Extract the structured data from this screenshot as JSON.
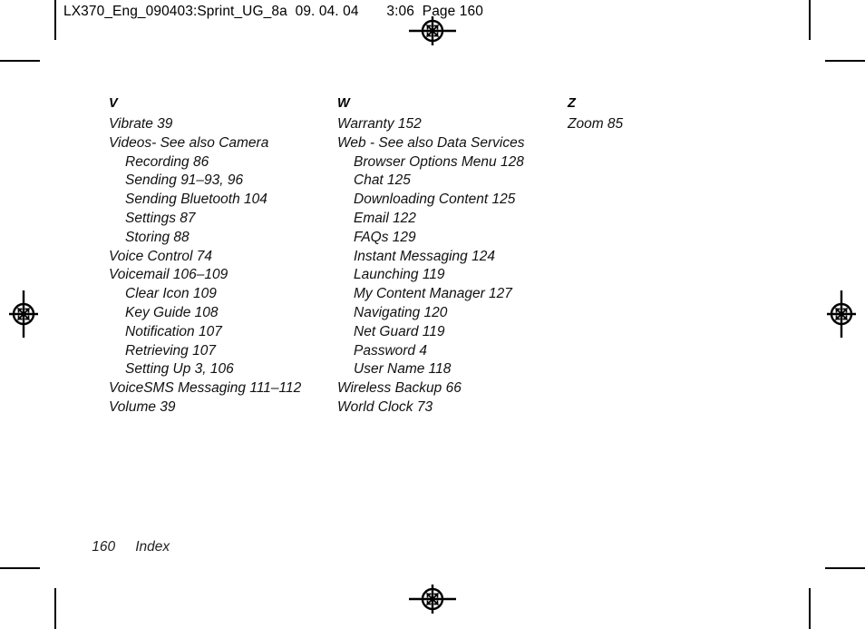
{
  "header": {
    "slug": "LX370_Eng_090403:Sprint_UG_8a  09. 04. 04       3:06  Page 160"
  },
  "index": {
    "columns": [
      {
        "letter": "V",
        "entries": [
          {
            "text": "Vibrate 39",
            "level": 0
          },
          {
            "text": "Videos- See also Camera",
            "level": 0
          },
          {
            "text": "Recording 86",
            "level": 1
          },
          {
            "text": "Sending 91–93, 96",
            "level": 1
          },
          {
            "text": "Sending Bluetooth 104",
            "level": 1
          },
          {
            "text": "Settings 87",
            "level": 1
          },
          {
            "text": "Storing 88",
            "level": 1
          },
          {
            "text": "Voice Control 74",
            "level": 0
          },
          {
            "text": "Voicemail 106–109",
            "level": 0
          },
          {
            "text": "Clear Icon 109",
            "level": 1
          },
          {
            "text": "Key Guide 108",
            "level": 1
          },
          {
            "text": "Notification 107",
            "level": 1
          },
          {
            "text": "Retrieving 107",
            "level": 1
          },
          {
            "text": "Setting Up 3, 106",
            "level": 1
          },
          {
            "text": "VoiceSMS Messaging 111–112",
            "level": 0
          },
          {
            "text": "Volume 39",
            "level": 0
          }
        ]
      },
      {
        "letter": "W",
        "entries": [
          {
            "text": "Warranty 152",
            "level": 0
          },
          {
            "text": "Web - See also Data Services",
            "level": 0
          },
          {
            "text": "Browser Options Menu 128",
            "level": 1
          },
          {
            "text": "Chat 125",
            "level": 1
          },
          {
            "text": "Downloading Content 125",
            "level": 1
          },
          {
            "text": "Email 122",
            "level": 1
          },
          {
            "text": "FAQs 129",
            "level": 1
          },
          {
            "text": "Instant Messaging 124",
            "level": 1
          },
          {
            "text": "Launching 119",
            "level": 1
          },
          {
            "text": "My Content Manager 127",
            "level": 1
          },
          {
            "text": "Navigating 120",
            "level": 1
          },
          {
            "text": "Net Guard 119",
            "level": 1
          },
          {
            "text": "Password 4",
            "level": 1
          },
          {
            "text": "User Name 118",
            "level": 1
          },
          {
            "text": "Wireless Backup 66",
            "level": 0
          },
          {
            "text": "World Clock 73",
            "level": 0
          }
        ]
      },
      {
        "letter": "Z",
        "entries": [
          {
            "text": "Zoom 85",
            "level": 0
          }
        ]
      }
    ]
  },
  "footer": {
    "page_number": "160",
    "section_label": "Index"
  }
}
